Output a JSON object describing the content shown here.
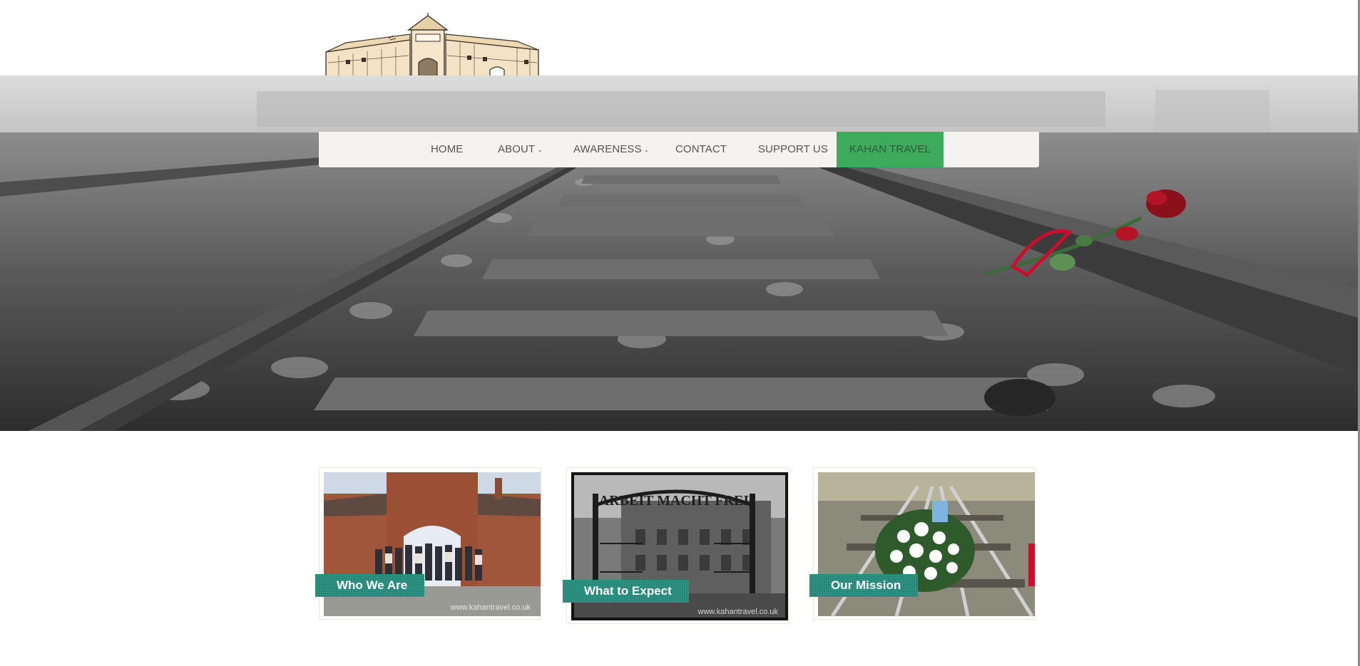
{
  "brand": {
    "logo_icon": "auschwitz-gate-sketch-logo"
  },
  "nav": {
    "items": [
      {
        "label": "HOME",
        "has_dropdown": false
      },
      {
        "label": "ABOUT",
        "has_dropdown": true
      },
      {
        "label": "AWARENESS",
        "has_dropdown": true
      },
      {
        "label": "CONTACT",
        "has_dropdown": false
      },
      {
        "label": "SUPPORT US",
        "has_dropdown": false
      },
      {
        "label": "KAHAN TRAVEL",
        "has_dropdown": false,
        "active": true
      }
    ],
    "dropdown_icon": "chevron-down-icon",
    "active_color": "#3daa5c"
  },
  "hero": {
    "image": "railway-tracks-with-red-rose"
  },
  "cards": [
    {
      "label": "Who We Are",
      "image": "group-at-birkenau-gate",
      "watermark": "www.kahantravel.co.uk"
    },
    {
      "label": "What to Expect",
      "image": "arbeit-macht-frei-gate",
      "gate_text": "ARBEIT MACHT FREI",
      "watermark": "www.kahantravel.co.uk"
    },
    {
      "label": "Our Mission",
      "image": "flowers-on-railway-tracks",
      "watermark": ""
    }
  ],
  "colors": {
    "label_teal": "#1e8676",
    "nav_bg": "#f5f3ef",
    "nav_text": "#555555"
  }
}
